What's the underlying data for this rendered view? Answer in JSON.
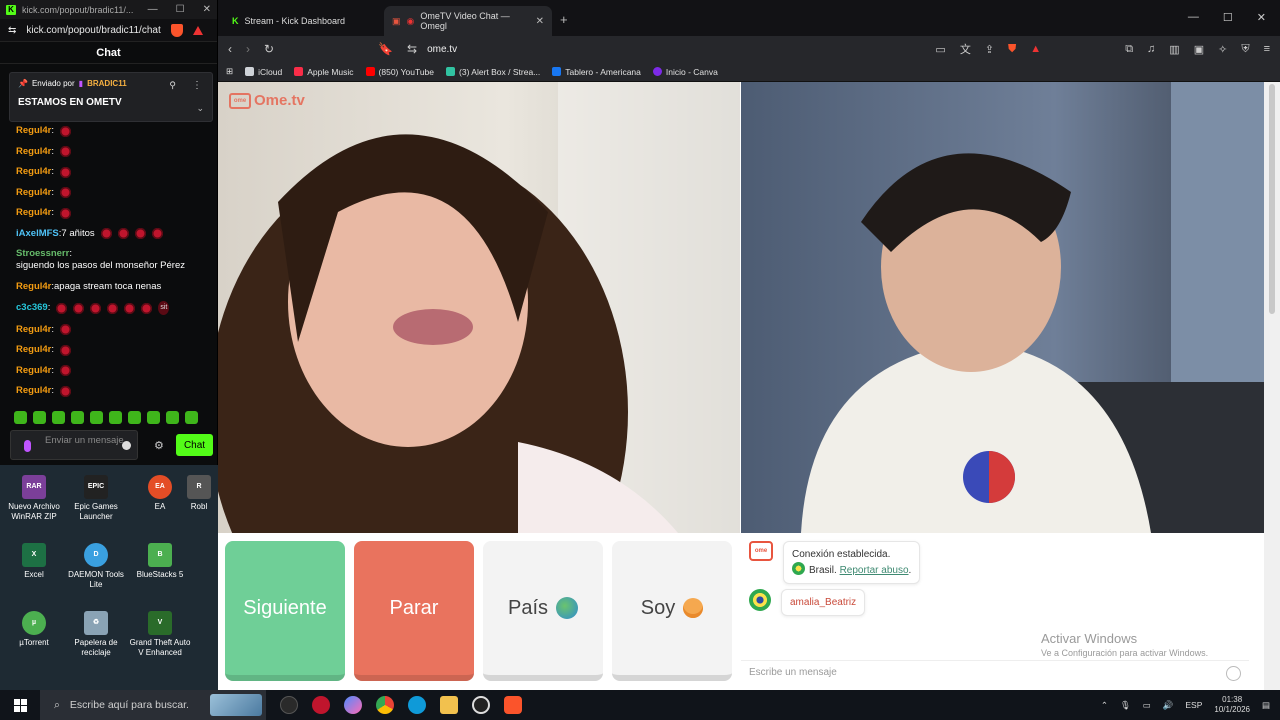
{
  "kick": {
    "url": "kick.com/popout/bradic11/chat",
    "title_url": "kick.com/popout/bradic11/...",
    "header": "Chat",
    "pinned": {
      "sent_by": "Enviado por",
      "user": "BRADIC11",
      "message": "ESTAMOS EN OMETV"
    },
    "messages": [
      {
        "user": "Regul4r",
        "color": "#f39c12",
        "text": "",
        "emotes": 1
      },
      {
        "user": "Regul4r",
        "color": "#f39c12",
        "text": "",
        "emotes": 1
      },
      {
        "user": "Regul4r",
        "color": "#f39c12",
        "text": "",
        "emotes": 1
      },
      {
        "user": "Regul4r",
        "color": "#f39c12",
        "text": "",
        "emotes": 1
      },
      {
        "user": "Regul4r",
        "color": "#f39c12",
        "text": "",
        "emotes": 1
      },
      {
        "user": "iAxelMFS",
        "color": "#4fc3f7",
        "text": "7 añitos",
        "emotes": 4
      },
      {
        "user": "Stroessnerr",
        "color": "#66bb6a",
        "text": "siguendo los pasos del monseñor Pérez",
        "emotes": 0
      },
      {
        "user": "Regul4r",
        "color": "#f39c12",
        "text": "apaga stream toca nenas",
        "emotes": 0
      },
      {
        "user": "c3c369",
        "color": "#26c6da",
        "text": "",
        "emotes": 6,
        "suffix": "sit"
      },
      {
        "user": "Regul4r",
        "color": "#f39c12",
        "text": "",
        "emotes": 1
      },
      {
        "user": "Regul4r",
        "color": "#f39c12",
        "text": "",
        "emotes": 1
      },
      {
        "user": "Regul4r",
        "color": "#f39c12",
        "text": "",
        "emotes": 1
      },
      {
        "user": "Regul4r",
        "color": "#f39c12",
        "text": "",
        "emotes": 1
      }
    ],
    "input_placeholder": "Enviar un mensaje",
    "send_label": "Chat"
  },
  "desktop": {
    "icons": [
      {
        "label": "Nuevo Archivo WinRAR ZIP",
        "icon": "winrar-icon"
      },
      {
        "label": "Epic Games Launcher",
        "icon": "epic-games-icon"
      },
      {
        "label": "EA",
        "icon": "ea-icon"
      },
      {
        "label": "Robl",
        "icon": "roblox-icon"
      },
      {
        "label": "Excel",
        "icon": "excel-icon"
      },
      {
        "label": "DAEMON Tools Lite",
        "icon": "daemon-tools-icon"
      },
      {
        "label": "BlueStacks 5",
        "icon": "bluestacks-icon"
      },
      {
        "label": "µTorrent",
        "icon": "utorrent-icon"
      },
      {
        "label": "Papelera de reciclaje",
        "icon": "recycle-bin-icon"
      },
      {
        "label": "Grand Theft Auto V Enhanced",
        "icon": "gta-icon"
      }
    ]
  },
  "browser": {
    "tabs": [
      {
        "label": "Stream - Kick Dashboard"
      },
      {
        "label": "OmeTV Video Chat — Omegl"
      }
    ],
    "url": "ome.tv",
    "bookmarks": [
      {
        "label": "iCloud",
        "color": "#cfd3d8"
      },
      {
        "label": "Apple Music",
        "color": "#fa2d48"
      },
      {
        "label": "(850) YouTube",
        "color": "#ff0000"
      },
      {
        "label": "(3) Alert Box / Strea...",
        "color": "#31c3a2"
      },
      {
        "label": "Tablero - Americana",
        "color": "#1877f2"
      },
      {
        "label": "Inicio - Canva",
        "color": "#7d2ae8"
      }
    ]
  },
  "ometv": {
    "logo": "Ome.tv",
    "buttons": {
      "next": "Siguiente",
      "stop": "Parar",
      "country": "País",
      "gender": "Soy"
    },
    "system_message": "Conexión establecida.",
    "country": "Brasil.",
    "report": "Reportar abuso",
    "partner": "amalia_Beatriz",
    "input_placeholder": "Escribe un mensaje",
    "watermark_title": "Activar Windows",
    "watermark_sub": "Ve a Configuración para activar Windows."
  },
  "taskbar": {
    "search_placeholder": "Escribe aquí para buscar.",
    "lang": "ESP",
    "time": "01:38",
    "date": "10/1/2026"
  }
}
